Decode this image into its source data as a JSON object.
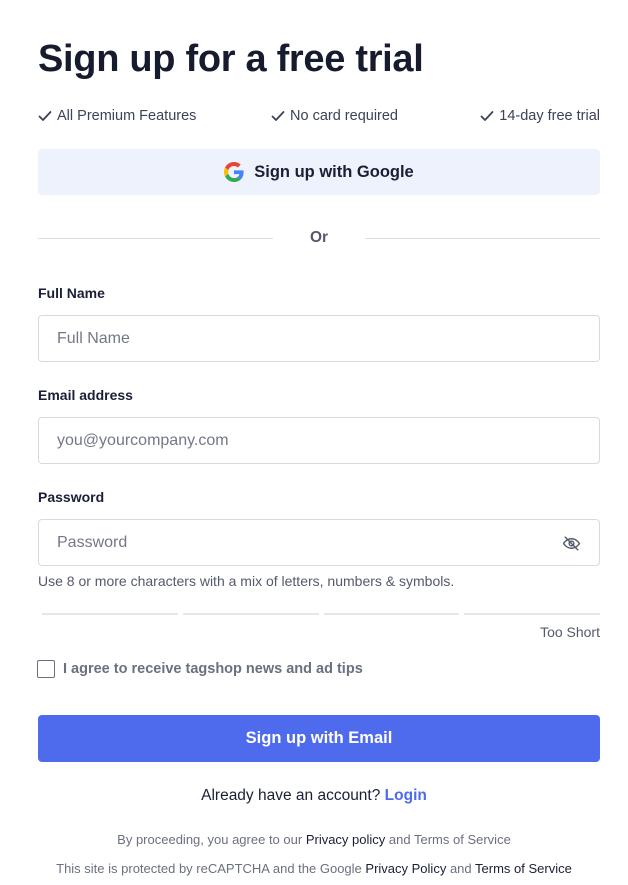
{
  "title": "Sign up for a free trial",
  "features": [
    "All Premium Features",
    "No card required",
    "14-day free trial"
  ],
  "google_button": "Sign up with Google",
  "divider_text": "Or",
  "full_name": {
    "label": "Full Name",
    "placeholder": "Full Name",
    "value": ""
  },
  "email": {
    "label": "Email address",
    "placeholder": "you@yourcompany.com",
    "value": ""
  },
  "password": {
    "label": "Password",
    "placeholder": "Password",
    "value": "",
    "hint": "Use 8 or more characters with a mix of letters, numbers & symbols.",
    "strength_label": "Too Short",
    "strength_segments": 4,
    "strength_level": 0
  },
  "agree": {
    "label": "I agree to receive tagshop news and ad tips",
    "checked": false
  },
  "email_button": "Sign up with Email",
  "login": {
    "prompt": "Already have an account?",
    "link": "Login"
  },
  "legal": {
    "line1_prefix": "By proceeding, you agree to our",
    "line1_privacy": "Privacy policy",
    "line1_and": "and",
    "line1_terms": "Terms of Service",
    "line2_prefix": "This site is protected by reCAPTCHA and the Google",
    "line2_privacy": "Privacy Policy",
    "line2_and": "and",
    "line2_terms": "Terms of Service"
  },
  "colors": {
    "primary": "#4f6bed",
    "google_bg": "#eef2fc",
    "text": "#1a1f36",
    "muted": "#6b7080",
    "border": "#d7dae2"
  },
  "icons": {
    "feature": "check-icon",
    "google": "google-logo-icon",
    "password_toggle": "eye-off-icon"
  }
}
